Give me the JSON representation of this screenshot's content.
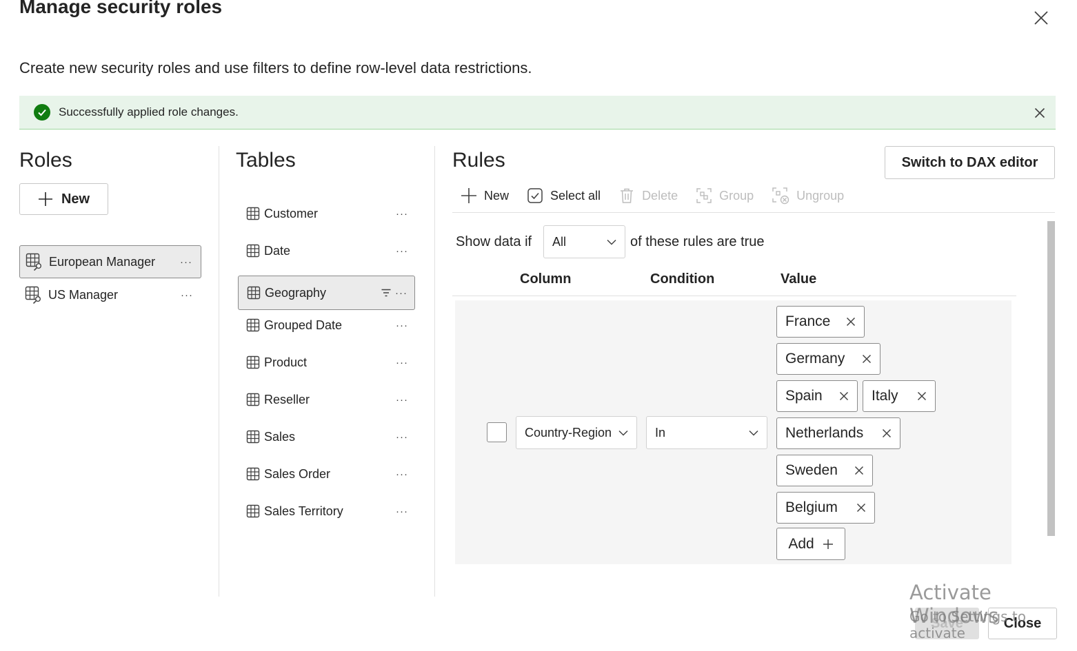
{
  "dialog": {
    "title": "Manage security roles",
    "subtitle": "Create new security roles and use filters to define row-level data restrictions."
  },
  "banner": {
    "message": "Successfully applied role changes.",
    "color": "#107c10"
  },
  "roles": {
    "heading": "Roles",
    "new_label": "New",
    "items": [
      {
        "label": "European Manager",
        "selected": true
      },
      {
        "label": "US Manager",
        "selected": false
      }
    ]
  },
  "tables": {
    "heading": "Tables",
    "items": [
      {
        "label": "Customer"
      },
      {
        "label": "Date"
      },
      {
        "label": "Geography",
        "selected": true,
        "filtered": true
      },
      {
        "label": "Grouped Date"
      },
      {
        "label": "Product"
      },
      {
        "label": "Reseller"
      },
      {
        "label": "Sales"
      },
      {
        "label": "Sales Order"
      },
      {
        "label": "Sales Territory"
      }
    ]
  },
  "rules": {
    "heading": "Rules",
    "dax_label": "Switch to DAX editor",
    "toolbar": {
      "new_label": "New",
      "select_all_label": "Select all",
      "delete_label": "Delete",
      "group_label": "Group",
      "ungroup_label": "Ungroup"
    },
    "show_prefix": "Show data if",
    "match_mode": "All",
    "show_suffix": "of these rules are true",
    "headers": {
      "column": "Column",
      "condition": "Condition",
      "value": "Value"
    },
    "rule": {
      "column": "Country-Region",
      "condition": "In",
      "values": [
        "France",
        "Germany",
        "Spain",
        "Italy",
        "Netherlands",
        "Sweden",
        "Belgium"
      ],
      "add_label": "Add"
    }
  },
  "footer": {
    "save_label": "Save",
    "close_label": "Close"
  },
  "watermark": {
    "line1": "Activate Windows",
    "line2": "Go to Settings to activate"
  }
}
